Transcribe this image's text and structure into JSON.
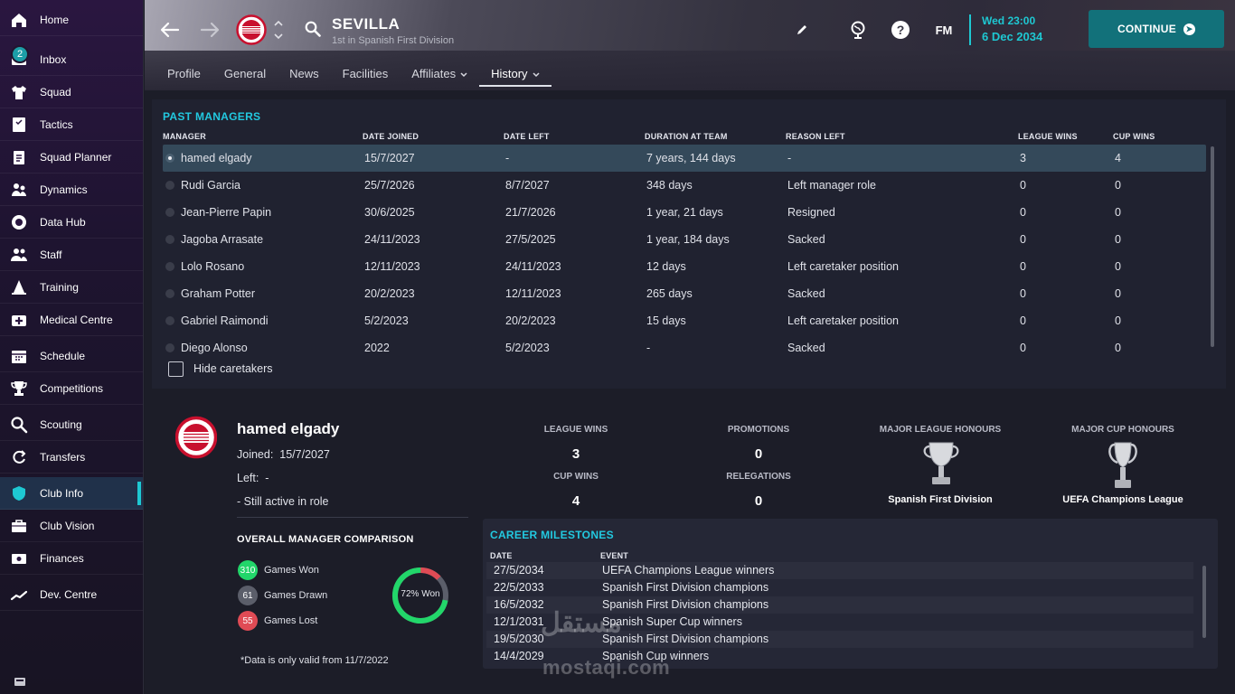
{
  "sidebar": {
    "items": [
      {
        "label": "Home",
        "icon": "home-icon"
      },
      {
        "label": "Inbox",
        "icon": "inbox-icon",
        "badge": "2"
      },
      {
        "label": "Squad",
        "icon": "shirt-icon"
      },
      {
        "label": "Tactics",
        "icon": "tactics-board-icon"
      },
      {
        "label": "Squad Planner",
        "icon": "clipboard-icon"
      },
      {
        "label": "Dynamics",
        "icon": "people-icon"
      },
      {
        "label": "Data Hub",
        "icon": "data-circle-icon"
      },
      {
        "label": "Staff",
        "icon": "staff-icon"
      },
      {
        "label": "Training",
        "icon": "cone-icon"
      },
      {
        "label": "Medical Centre",
        "icon": "medical-icon"
      },
      {
        "label": "Schedule",
        "icon": "calendar-icon"
      },
      {
        "label": "Competitions",
        "icon": "trophy-icon"
      },
      {
        "label": "Scouting",
        "icon": "magnifier-icon"
      },
      {
        "label": "Transfers",
        "icon": "transfer-arrows-icon"
      },
      {
        "label": "Club Info",
        "icon": "shield-icon"
      },
      {
        "label": "Club Vision",
        "icon": "briefcase-icon"
      },
      {
        "label": "Finances",
        "icon": "money-icon"
      },
      {
        "label": "Dev. Centre",
        "icon": "chart-line-icon"
      }
    ]
  },
  "header": {
    "club_name": "SEVILLA",
    "club_subtitle": "1st in Spanish First Division",
    "tabs": [
      {
        "label": "Profile",
        "active": false,
        "dropdown": false
      },
      {
        "label": "General",
        "active": false,
        "dropdown": false
      },
      {
        "label": "News",
        "active": false,
        "dropdown": false
      },
      {
        "label": "Facilities",
        "active": false,
        "dropdown": false
      },
      {
        "label": "Affiliates",
        "active": false,
        "dropdown": true
      },
      {
        "label": "History",
        "active": true,
        "dropdown": true
      }
    ],
    "fm_label": "FM",
    "date_day": "Wed 23:00",
    "date": "6 Dec 2034",
    "continue_label": "CONTINUE",
    "accent_color": "#1ec8d2"
  },
  "past_managers": {
    "title": "PAST MANAGERS",
    "columns": [
      "MANAGER",
      "DATE JOINED",
      "DATE LEFT",
      "DURATION AT TEAM",
      "REASON LEFT",
      "LEAGUE WINS",
      "CUP WINS"
    ],
    "rows": [
      {
        "name": "hamed elgady",
        "joined": "15/7/2027",
        "left": "-",
        "duration": "7 years, 144 days",
        "reason": "-",
        "league": "3",
        "cup": "4",
        "selected": true
      },
      {
        "name": "Rudi Garcia",
        "joined": "25/7/2026",
        "left": "8/7/2027",
        "duration": "348 days",
        "reason": "Left manager role",
        "league": "0",
        "cup": "0"
      },
      {
        "name": "Jean-Pierre Papin",
        "joined": "30/6/2025",
        "left": "21/7/2026",
        "duration": "1 year, 21 days",
        "reason": "Resigned",
        "league": "0",
        "cup": "0"
      },
      {
        "name": "Jagoba Arrasate",
        "joined": "24/11/2023",
        "left": "27/5/2025",
        "duration": "1 year, 184 days",
        "reason": "Sacked",
        "league": "0",
        "cup": "0"
      },
      {
        "name": "Lolo Rosano",
        "joined": "12/11/2023",
        "left": "24/11/2023",
        "duration": "12 days",
        "reason": "Left caretaker position",
        "league": "0",
        "cup": "0"
      },
      {
        "name": "Graham Potter",
        "joined": "20/2/2023",
        "left": "12/11/2023",
        "duration": "265 days",
        "reason": "Sacked",
        "league": "0",
        "cup": "0"
      },
      {
        "name": "Gabriel Raimondi",
        "joined": "5/2/2023",
        "left": "20/2/2023",
        "duration": "15 days",
        "reason": "Left caretaker position",
        "league": "0",
        "cup": "0"
      },
      {
        "name": "Diego Alonso",
        "joined": "2022",
        "left": "5/2/2023",
        "duration": "-",
        "reason": "Sacked",
        "league": "0",
        "cup": "0"
      }
    ],
    "hide_caretakers_label": "Hide caretakers"
  },
  "manager_detail": {
    "name": "hamed elgady",
    "joined_label": "Joined:",
    "joined": "15/7/2027",
    "left_label": "Left:",
    "left": "-",
    "status": "- Still active in role",
    "stats": {
      "league_wins_label": "LEAGUE WINS",
      "league_wins": "3",
      "promotions_label": "PROMOTIONS",
      "promotions": "0",
      "cup_wins_label": "CUP WINS",
      "cup_wins": "4",
      "relegations_label": "RELEGATIONS",
      "relegations": "0"
    },
    "honours": {
      "league_label": "MAJOR LEAGUE HONOURS",
      "league_name": "Spanish First Division",
      "cup_label": "MAJOR CUP HONOURS",
      "cup_name": "UEFA Champions League"
    },
    "comparison": {
      "title": "OVERALL MANAGER COMPARISON",
      "won": "310",
      "won_label": "Games Won",
      "drawn": "61",
      "drawn_label": "Games Drawn",
      "lost": "55",
      "lost_label": "Games Lost",
      "won_pct": 72,
      "donut_label": "72% Won",
      "won_color": "#22d66a",
      "drawn_color": "#5b5e6a",
      "lost_color": "#e04b55"
    },
    "note": "*Data is only valid from 11/7/2022"
  },
  "milestones": {
    "title": "CAREER MILESTONES",
    "date_col": "DATE",
    "event_col": "EVENT",
    "rows": [
      {
        "date": "27/5/2034",
        "event": "UEFA Champions League winners"
      },
      {
        "date": "22/5/2033",
        "event": "Spanish First Division champions"
      },
      {
        "date": "16/5/2032",
        "event": "Spanish First Division champions"
      },
      {
        "date": "12/1/2031",
        "event": "Spanish Super Cup winners"
      },
      {
        "date": "19/5/2030",
        "event": "Spanish First Division champions"
      },
      {
        "date": "14/4/2029",
        "event": "Spanish Cup winners"
      }
    ]
  },
  "watermark": {
    "arabic": "مستقل",
    "latin": "mostaqi.com"
  }
}
